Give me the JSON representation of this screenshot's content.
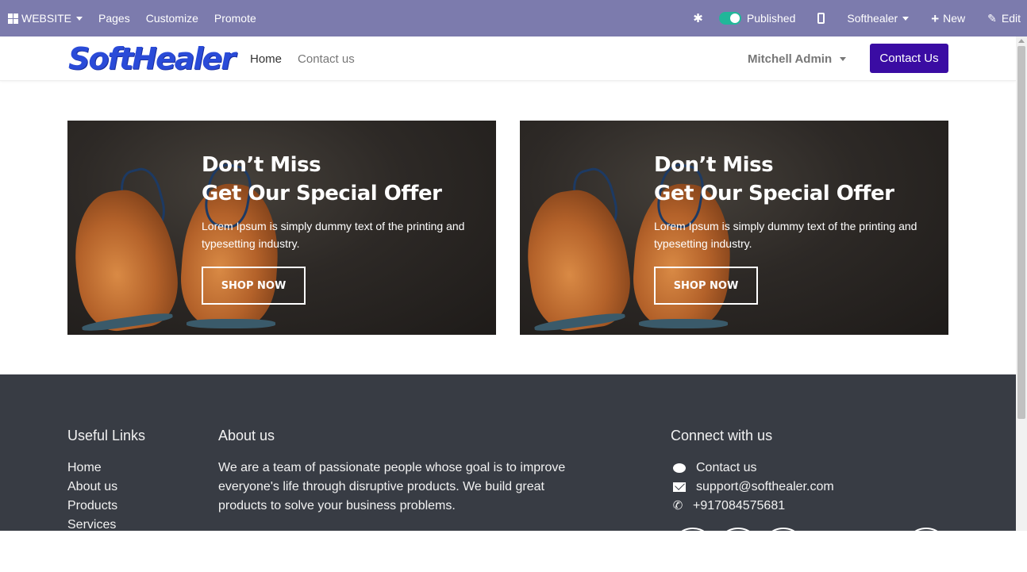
{
  "admin_bar": {
    "website_menu": "WEBSITE",
    "pages": "Pages",
    "customize": "Customize",
    "promote": "Promote",
    "published_label": "Published",
    "company_menu": "Softhealer",
    "new_label": "New",
    "edit_label": "Edit",
    "bar_color": "#7c7bad"
  },
  "header": {
    "logo_text": "SoftHealer",
    "nav": [
      {
        "label": "Home",
        "active": true
      },
      {
        "label": "Contact us",
        "active": false
      }
    ],
    "user_menu": "Mitchell Admin",
    "cta_label": "Contact Us",
    "cta_color": "#3a0ca3"
  },
  "banners": [
    {
      "heading_line1": "Don’t Miss",
      "heading_line2": "Get Our Special Offer",
      "body": "Lorem Ipsum is simply dummy text of the printing and typesetting industry.",
      "button": "SHOP NOW"
    },
    {
      "heading_line1": "Don’t Miss",
      "heading_line2": "Get Our Special Offer",
      "body": "Lorem Ipsum is simply dummy text of the printing and typesetting industry.",
      "button": "SHOP NOW"
    }
  ],
  "footer": {
    "useful_links_title": "Useful Links",
    "useful_links": [
      "Home",
      "About us",
      "Products",
      "Services"
    ],
    "about_title": "About us",
    "about_text": "We are a team of passionate people whose goal is to improve everyone's life through disruptive products. We build great products to solve your business problems.",
    "connect_title": "Connect with us",
    "contact_link": "Contact us",
    "email": "support@softhealer.com",
    "phone": "+917084575681",
    "background_color": "#383c44"
  }
}
